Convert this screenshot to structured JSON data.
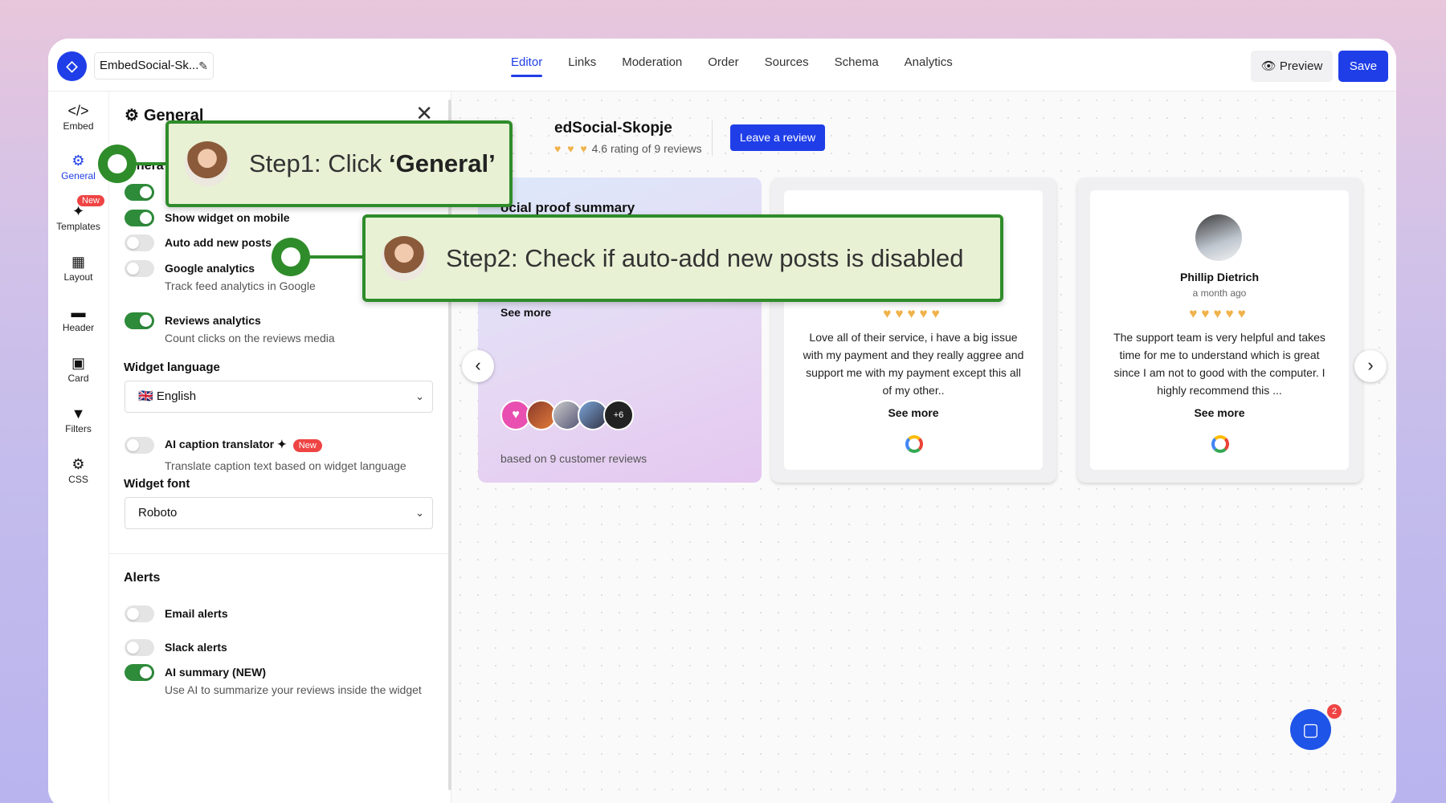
{
  "app": {
    "logo_glyph": "◇",
    "project_name": "EmbedSocial-Sk...",
    "edit_icon": "pencil-icon"
  },
  "tabs": [
    {
      "label": "Editor",
      "active": true
    },
    {
      "label": "Links"
    },
    {
      "label": "Moderation"
    },
    {
      "label": "Order"
    },
    {
      "label": "Sources"
    },
    {
      "label": "Schema"
    },
    {
      "label": "Analytics"
    }
  ],
  "actions": {
    "preview_label": "Preview",
    "save_label": "Save"
  },
  "rail": [
    {
      "label": "Embed",
      "icon": "</>"
    },
    {
      "label": "General",
      "icon": "⚙",
      "active": true
    },
    {
      "label": "Templates",
      "icon": "✦",
      "badge": "New"
    },
    {
      "label": "Layout",
      "icon": "▦"
    },
    {
      "label": "Header",
      "icon": "▬"
    },
    {
      "label": "Card",
      "icon": "▣"
    },
    {
      "label": "Filters",
      "icon": "▼"
    },
    {
      "label": "CSS",
      "icon": "⚙"
    }
  ],
  "panel": {
    "title": "General",
    "section_general": "enera",
    "options": {
      "mobile": {
        "label": "Show widget on mobile"
      },
      "auto_add": {
        "label": "Auto add new posts"
      },
      "google_analytics": {
        "label": "Google analytics",
        "desc": "Track feed analytics in Google"
      },
      "reviews_analytics": {
        "label": "Reviews analytics",
        "desc": "Count clicks on the reviews media"
      }
    },
    "widget_language_label": "Widget language",
    "widget_language_value": "🇬🇧 English",
    "ai_caption": {
      "label": "AI caption translator ✦",
      "badge": "New",
      "desc": "Translate caption text based on widget language"
    },
    "widget_font_label": "Widget font",
    "widget_font_value": "Roboto",
    "alerts_title": "Alerts",
    "alerts": {
      "email": "Email alerts",
      "slack": "Slack alerts",
      "ai_summary": {
        "label": "AI summary (NEW)",
        "desc": "Use AI to summarize your reviews inside the widget"
      }
    }
  },
  "canvas": {
    "business_name": "edSocial-Skopje",
    "rating_text": "4.6 rating of 9 reviews",
    "rating_hearts": "♥ ♥ ♥",
    "leave_review": "Leave a review",
    "summary": {
      "title": "ocial proof summary",
      "see_more": "See more",
      "extra_count": "+6",
      "based_on": "based on 9 customer reviews"
    },
    "reviews": [
      {
        "hearts": "♥♥♥♥♥",
        "text": "Love all of their service, i have a big issue with my payment and they really aggree and support me with my payment except this all of my other..",
        "see_more": "See more"
      },
      {
        "name": "Phillip Dietrich",
        "time": "a month ago",
        "hearts": "♥♥♥♥♥",
        "text": "The support team is very helpful and takes time for me to understand which is great since I am not to good with the computer. I highly recommend this ...",
        "see_more": "See more"
      }
    ]
  },
  "chat_badge": "2",
  "callouts": {
    "step1_prefix": "Step1: Click ",
    "step1_target": "‘General’",
    "step2": "Step2: Check if auto-add new posts is disabled"
  },
  "colors": {
    "accent": "#1f3ee8",
    "toggle_on": "#2e8b3a",
    "callout_border": "#2f8c2a",
    "heart": "#f0b24a"
  }
}
